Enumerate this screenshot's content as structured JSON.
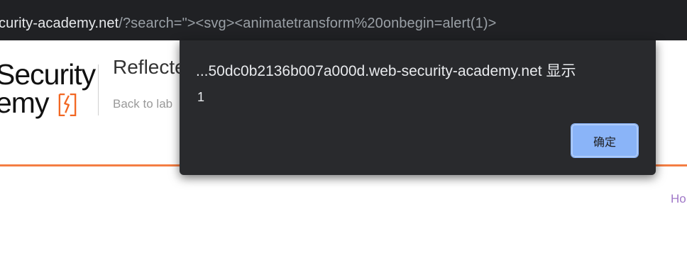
{
  "browser": {
    "url_host": "curity-academy.net",
    "url_path": "/?search=\"><svg><animatetransform%20onbegin=alert(1)>"
  },
  "page": {
    "logo_line1": "Security",
    "logo_line2": "emy",
    "lab_title": "Reflecte",
    "back_link": "Back to lab",
    "home_link": "Ho"
  },
  "dialog": {
    "title": "...50dc0b2136b007a000d.web-security-academy.net 显示",
    "message": "1",
    "ok_label": "确定"
  },
  "colors": {
    "brand_orange": "#f26722",
    "dialog_bg": "#292a2d",
    "button_blue": "#8ab4f8"
  }
}
